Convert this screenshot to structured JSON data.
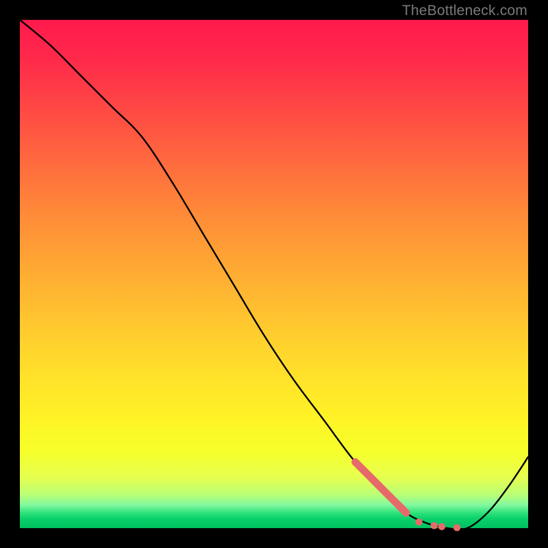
{
  "watermark": "TheBottleneck.com",
  "colors": {
    "curve_stroke": "#000000",
    "marker_fill": "#e76a6a",
    "marker_stroke": "#e76a6a"
  },
  "chart_data": {
    "type": "line",
    "title": "",
    "xlabel": "",
    "ylabel": "",
    "xlim": [
      0,
      100
    ],
    "ylim": [
      0,
      100
    ],
    "grid": false,
    "legend": false,
    "series": [
      {
        "name": "bottleneck-curve",
        "x": [
          0,
          6,
          12,
          18,
          24,
          30,
          36,
          42,
          48,
          54,
          60,
          66,
          72,
          76,
          80,
          84,
          88,
          92,
          96,
          100
        ],
        "y": [
          100,
          95,
          89,
          83,
          77,
          68,
          58,
          48,
          38,
          29,
          21,
          13,
          7,
          3,
          1,
          0,
          0,
          3,
          8,
          14
        ]
      }
    ],
    "highlight_segment": {
      "name": "marker-band",
      "x": [
        66,
        68,
        70,
        72,
        74,
        76
      ],
      "y": [
        13,
        11,
        9,
        7,
        5,
        3
      ]
    },
    "highlight_points": [
      {
        "x": 78.5,
        "y": 1.2
      },
      {
        "x": 81.5,
        "y": 0.5
      },
      {
        "x": 83.0,
        "y": 0.3
      },
      {
        "x": 86.0,
        "y": 0.1
      }
    ]
  }
}
